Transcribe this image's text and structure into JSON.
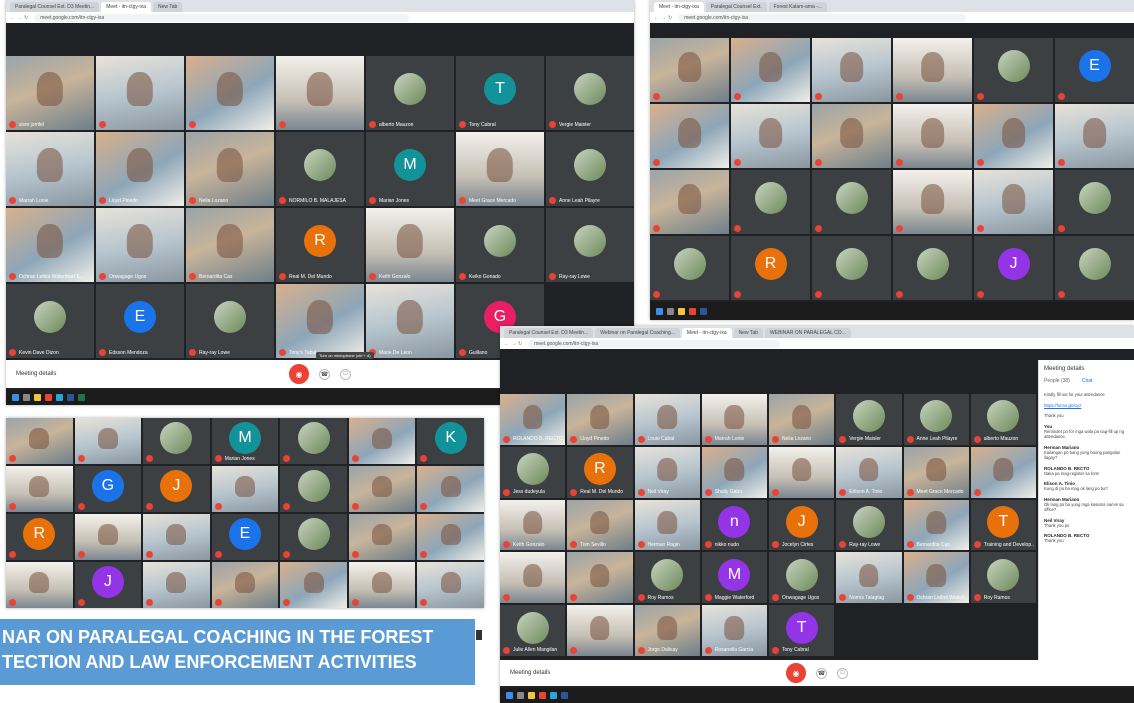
{
  "banner": {
    "line1": "NAR ON PARALEGAL COACHING IN THE FOREST",
    "line2": "TECTION AND LAW ENFORCEMENT ACTIVITIES"
  },
  "colors": {
    "meet_bg": "#202124",
    "tile_bg": "#3c4043",
    "banner_bg": "#5b9bd5",
    "end_call": "#ea4335"
  },
  "shot1": {
    "tabs": [
      "Paralegal Counsel Ext. D3 Meetin...",
      "Meet - itn-ctgy-ixa",
      "New Tab"
    ],
    "url": "meet.google.com/itn-ctgy-ixa",
    "meeting_details": "Meeting details",
    "tooltip": "Turn on microphone (ctrl + d)",
    "tiles": [
      {
        "kind": "video",
        "name": "sioni jomfel",
        "style": "v1"
      },
      {
        "kind": "video",
        "name": "",
        "style": "v2"
      },
      {
        "kind": "video",
        "name": "",
        "style": "v3"
      },
      {
        "kind": "video",
        "name": "",
        "style": "v4"
      },
      {
        "kind": "avatar",
        "letter": "",
        "color": "photo",
        "name": "alberto Mauzon"
      },
      {
        "kind": "avatar",
        "letter": "T",
        "color": "#12939a",
        "name": "Tony Cabral"
      },
      {
        "kind": "avatar",
        "letter": "",
        "color": "photo",
        "name": "Vergie Maister"
      },
      {
        "kind": "video",
        "name": "Marrah Lonie",
        "style": "v2"
      },
      {
        "kind": "video",
        "name": "Lloyd Pinedo",
        "style": "v3"
      },
      {
        "kind": "video",
        "name": "Nelia Lozano",
        "style": "v1"
      },
      {
        "kind": "avatar",
        "letter": "",
        "color": "photo",
        "name": "NORMILO B. MALAJESA"
      },
      {
        "kind": "avatar",
        "letter": "M",
        "color": "#12939a",
        "name": "Marian Jones"
      },
      {
        "kind": "video",
        "name": "Meet Grace Mercado",
        "style": "v4"
      },
      {
        "kind": "avatar",
        "letter": "",
        "color": "photo",
        "name": "Anne Leah Pilayre"
      },
      {
        "kind": "video",
        "name": "Ochran Leibot Waterthart S...",
        "style": "v3"
      },
      {
        "kind": "video",
        "name": "Onwagage Ugos",
        "style": "v2"
      },
      {
        "kind": "video",
        "name": "Bernardita Cas",
        "style": "v1"
      },
      {
        "kind": "avatar",
        "letter": "R",
        "color": "#e8710a",
        "name": "Real M. Del Mundo"
      },
      {
        "kind": "video",
        "name": "Keith Gonzalo",
        "style": "v4"
      },
      {
        "kind": "avatar",
        "letter": "",
        "color": "photo",
        "name": "Keiko Gonado"
      },
      {
        "kind": "avatar",
        "letter": "",
        "color": "photo",
        "name": "Ray-ray Lowe"
      },
      {
        "kind": "avatar",
        "letter": "",
        "color": "photo",
        "name": "Kevin Dave Dizon"
      },
      {
        "kind": "avatar",
        "letter": "E",
        "color": "#1a73e8",
        "name": "Edsson Mendoza"
      },
      {
        "kind": "avatar",
        "letter": "",
        "color": "photo",
        "name": "Ray-ray Lowe"
      },
      {
        "kind": "video",
        "name": "Tony's Tabul",
        "style": "v3"
      },
      {
        "kind": "video",
        "name": "Marie De Leon",
        "style": "v2"
      },
      {
        "kind": "avatar",
        "letter": "G",
        "color": "#e91e63",
        "name": "Guillano"
      }
    ]
  },
  "shot2": {
    "tabs": [
      "Meet - itn-ctgy-ixa",
      "Paralegal Counsel Ext.",
      "Forest Kalam-ama -..."
    ],
    "url": "meet.google.com/itn-ctgy-ixa",
    "tiles": [
      {
        "kind": "video",
        "name": "",
        "style": "v1"
      },
      {
        "kind": "video",
        "name": "",
        "style": "v3"
      },
      {
        "kind": "video",
        "name": "",
        "style": "v2"
      },
      {
        "kind": "video",
        "name": "",
        "style": "v4"
      },
      {
        "kind": "avatar",
        "letter": "",
        "color": "photo",
        "name": ""
      },
      {
        "kind": "avatar",
        "letter": "E",
        "color": "#1a73e8",
        "name": ""
      },
      {
        "kind": "video",
        "name": "",
        "style": "v3"
      },
      {
        "kind": "video",
        "name": "",
        "style": "v2"
      },
      {
        "kind": "video",
        "name": "",
        "style": "v1"
      },
      {
        "kind": "video",
        "name": "",
        "style": "v4"
      },
      {
        "kind": "video",
        "name": "",
        "style": "v3"
      },
      {
        "kind": "video",
        "name": "",
        "style": "v2"
      },
      {
        "kind": "video",
        "name": "",
        "style": "v1"
      },
      {
        "kind": "avatar",
        "letter": "",
        "color": "photo",
        "name": ""
      },
      {
        "kind": "avatar",
        "letter": "",
        "color": "photo",
        "name": ""
      },
      {
        "kind": "video",
        "name": "",
        "style": "v4"
      },
      {
        "kind": "video",
        "name": "",
        "style": "v2"
      },
      {
        "kind": "avatar",
        "letter": "",
        "color": "photo",
        "name": ""
      },
      {
        "kind": "avatar",
        "letter": "",
        "color": "photo",
        "name": ""
      },
      {
        "kind": "avatar",
        "letter": "R",
        "color": "#e8710a",
        "name": ""
      },
      {
        "kind": "avatar",
        "letter": "",
        "color": "photo",
        "name": ""
      },
      {
        "kind": "avatar",
        "letter": "",
        "color": "photo",
        "name": ""
      },
      {
        "kind": "avatar",
        "letter": "J",
        "color": "#9334e6",
        "name": ""
      },
      {
        "kind": "avatar",
        "letter": "",
        "color": "photo",
        "name": ""
      }
    ]
  },
  "shot3": {
    "tiles": [
      {
        "kind": "video",
        "name": "",
        "style": "v1"
      },
      {
        "kind": "video",
        "name": "",
        "style": "v2"
      },
      {
        "kind": "avatar",
        "letter": "",
        "color": "photo",
        "name": ""
      },
      {
        "kind": "avatar",
        "letter": "M",
        "color": "#12939a",
        "name": "Marian Jones"
      },
      {
        "kind": "avatar",
        "letter": "",
        "color": "photo",
        "name": ""
      },
      {
        "kind": "video",
        "name": "",
        "style": "v3"
      },
      {
        "kind": "avatar",
        "letter": "K",
        "color": "#12939a",
        "name": ""
      },
      {
        "kind": "video",
        "name": "",
        "style": "v4"
      },
      {
        "kind": "avatar",
        "letter": "G",
        "color": "#1a73e8",
        "name": ""
      },
      {
        "kind": "avatar",
        "letter": "J",
        "color": "#e8710a",
        "name": ""
      },
      {
        "kind": "video",
        "name": "",
        "style": "v2"
      },
      {
        "kind": "avatar",
        "letter": "",
        "color": "photo",
        "name": ""
      },
      {
        "kind": "video",
        "name": "",
        "style": "v1"
      },
      {
        "kind": "video",
        "name": "",
        "style": "v3"
      },
      {
        "kind": "avatar",
        "letter": "R",
        "color": "#e8710a",
        "name": ""
      },
      {
        "kind": "video",
        "name": "",
        "style": "v4"
      },
      {
        "kind": "video",
        "name": "",
        "style": "v2"
      },
      {
        "kind": "avatar",
        "letter": "E",
        "color": "#1a73e8",
        "name": ""
      },
      {
        "kind": "avatar",
        "letter": "",
        "color": "photo",
        "name": ""
      },
      {
        "kind": "video",
        "name": "",
        "style": "v1"
      },
      {
        "kind": "video",
        "name": "",
        "style": "v3"
      },
      {
        "kind": "video",
        "name": "",
        "style": "v4"
      },
      {
        "kind": "avatar",
        "letter": "J",
        "color": "#9334e6",
        "name": ""
      },
      {
        "kind": "video",
        "name": "",
        "style": "v2"
      },
      {
        "kind": "video",
        "name": "",
        "style": "v1"
      },
      {
        "kind": "video",
        "name": "",
        "style": "v3"
      },
      {
        "kind": "video",
        "name": "",
        "style": "v4"
      },
      {
        "kind": "video",
        "name": "",
        "style": "v2"
      }
    ]
  },
  "shot4": {
    "tabs": [
      "Paralegal Counsel Ext. D3 Meetin...",
      "Webinar on Paralegal Coaching...",
      "Meet - itn-ctgy-ixa",
      "New Tab",
      "WEBINAR ON PARALEGAL CO..."
    ],
    "url": "meet.google.com/itn-ctgy-ixa",
    "meeting_details": "Meeting details",
    "panel": {
      "title": "Meeting details",
      "tab_people": "People (38)",
      "tab_chat": "Chat",
      "messages": [
        {
          "who": "",
          "text": "Kindly fill out for your attendance"
        },
        {
          "who": "",
          "text": "https://forms.gle/xyz"
        },
        {
          "who": "",
          "text": "Thank you"
        },
        {
          "who": "You",
          "text": "Reminder po for mga wala pa nag-fill up ng attendance."
        },
        {
          "who": "Herman Mariano",
          "text": "Kailangan po bang yung buong pangalan ilagay?"
        },
        {
          "who": "ROLANDO B. RECTO",
          "text": "Naka pa mag-register sa form"
        },
        {
          "who": "Elison A. Tinio",
          "text": "Kung di po ba mag ok lang po ba?"
        },
        {
          "who": "Herman Mariano",
          "text": "Ok lang po ba yung mga kasama namin sa office?"
        },
        {
          "who": "Neil Viray",
          "text": "Thank you po"
        },
        {
          "who": "ROLANDO B. RECTO",
          "text": "Thank you"
        }
      ]
    },
    "tiles": [
      {
        "kind": "video",
        "name": "ROLANDO B. RECTO",
        "style": "v3"
      },
      {
        "kind": "video",
        "name": "Lloyd Pinedo",
        "style": "v1"
      },
      {
        "kind": "video",
        "name": "Louie Cabal",
        "style": "v2"
      },
      {
        "kind": "video",
        "name": "Marrah Lonie",
        "style": "v4"
      },
      {
        "kind": "video",
        "name": "Nelia Lozano",
        "style": "v1"
      },
      {
        "kind": "avatar",
        "letter": "",
        "color": "photo",
        "name": "Vergie Maisler"
      },
      {
        "kind": "avatar",
        "letter": "",
        "color": "photo",
        "name": "Anne Leah Pilayre"
      },
      {
        "kind": "avatar",
        "letter": "",
        "color": "photo",
        "name": "alberto Mauzon"
      },
      {
        "kind": "avatar",
        "letter": "",
        "color": "photo",
        "name": "Jess dudeyula"
      },
      {
        "kind": "avatar",
        "letter": "R",
        "color": "#e8710a",
        "name": "Real M. Del Mundo"
      },
      {
        "kind": "video",
        "name": "Neil Viray",
        "style": "v2"
      },
      {
        "kind": "video",
        "name": "Shally Gabo",
        "style": "v3"
      },
      {
        "kind": "video",
        "name": "",
        "style": "v4"
      },
      {
        "kind": "video",
        "name": "Edison A. Tinio",
        "style": "v2"
      },
      {
        "kind": "video",
        "name": "Meet Grace Mercado",
        "style": "v1"
      },
      {
        "kind": "video",
        "name": "",
        "style": "v3"
      },
      {
        "kind": "video",
        "name": "Keith Gonzalo",
        "style": "v4"
      },
      {
        "kind": "video",
        "name": "Tom Sevillo",
        "style": "v1"
      },
      {
        "kind": "video",
        "name": "Herman Ragin",
        "style": "v2"
      },
      {
        "kind": "avatar",
        "letter": "n",
        "color": "#9334e6",
        "name": "nikko nudo"
      },
      {
        "kind": "avatar",
        "letter": "J",
        "color": "#e8710a",
        "name": "Jocelyn Cirtes"
      },
      {
        "kind": "avatar",
        "letter": "",
        "color": "photo",
        "name": "Ray-ray Lowe"
      },
      {
        "kind": "video",
        "name": "Bernardita Cas",
        "style": "v3"
      },
      {
        "kind": "avatar",
        "letter": "T",
        "color": "#e8710a",
        "name": "Training and Develop..."
      },
      {
        "kind": "video",
        "name": "",
        "style": "v4"
      },
      {
        "kind": "video",
        "name": "",
        "style": "v1"
      },
      {
        "kind": "avatar",
        "letter": "",
        "color": "photo",
        "name": "Roy Ramos"
      },
      {
        "kind": "avatar",
        "letter": "M",
        "color": "#9334e6",
        "name": "Maggie Waterford"
      },
      {
        "kind": "avatar",
        "letter": "",
        "color": "photo",
        "name": "Onwagage Ugos"
      },
      {
        "kind": "video",
        "name": "Norms Talagtag",
        "style": "v2"
      },
      {
        "kind": "video",
        "name": "Ochran Leibot Waterf...",
        "style": "v3"
      },
      {
        "kind": "avatar",
        "letter": "",
        "color": "photo",
        "name": "Roy Ramos"
      },
      {
        "kind": "avatar",
        "letter": "",
        "color": "photo",
        "name": "Julie Allen Mangilan"
      },
      {
        "kind": "video",
        "name": "",
        "style": "v4"
      },
      {
        "kind": "video",
        "name": "Jorge Dalisay",
        "style": "v1"
      },
      {
        "kind": "video",
        "name": "Rosanella Garcia",
        "style": "v2"
      },
      {
        "kind": "avatar",
        "letter": "T",
        "color": "#9334e6",
        "name": "Tony Cabral"
      }
    ]
  }
}
